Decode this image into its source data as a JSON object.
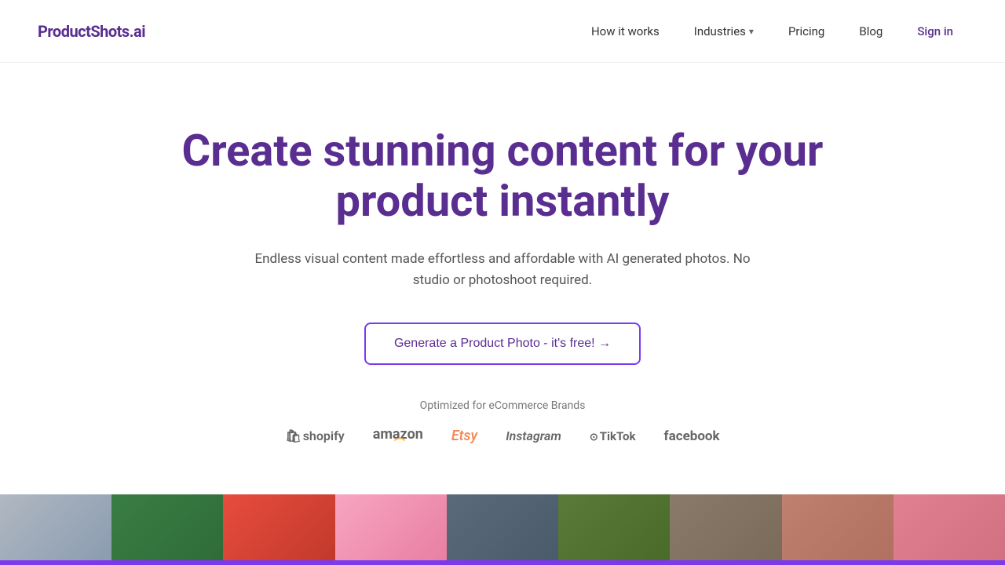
{
  "nav": {
    "logo": "ProductShots.ai",
    "links": [
      {
        "id": "how-it-works",
        "label": "How it works",
        "hasDropdown": false
      },
      {
        "id": "industries",
        "label": "Industries",
        "hasDropdown": true
      },
      {
        "id": "pricing",
        "label": "Pricing",
        "hasDropdown": false
      },
      {
        "id": "blog",
        "label": "Blog",
        "hasDropdown": false
      }
    ],
    "signin_label": "Sign in"
  },
  "hero": {
    "title": "Create stunning content for your product instantly",
    "subtitle": "Endless visual content made effortless and affordable with AI generated photos. No studio or photoshoot required.",
    "cta_label": "Generate a Product Photo - it's free! →"
  },
  "brands": {
    "label": "Optimized for eCommerce Brands",
    "logos": [
      {
        "id": "shopify",
        "text": "🛍 shopify"
      },
      {
        "id": "amazon",
        "text": "amazon"
      },
      {
        "id": "etsy",
        "text": "Etsy"
      },
      {
        "id": "instagram",
        "text": "Instagram"
      },
      {
        "id": "tiktok",
        "text": "⊙ TikTok"
      },
      {
        "id": "facebook",
        "text": "facebook"
      }
    ]
  },
  "image_strip": {
    "items": [
      {
        "id": "strip-0"
      },
      {
        "id": "strip-1"
      },
      {
        "id": "strip-2"
      },
      {
        "id": "strip-3"
      },
      {
        "id": "strip-4"
      },
      {
        "id": "strip-5"
      },
      {
        "id": "strip-6"
      },
      {
        "id": "strip-7"
      },
      {
        "id": "strip-8"
      }
    ]
  },
  "colors": {
    "accent": "#7c3aed",
    "logo_color": "#5a2d91",
    "title_color": "#5a2d91"
  }
}
